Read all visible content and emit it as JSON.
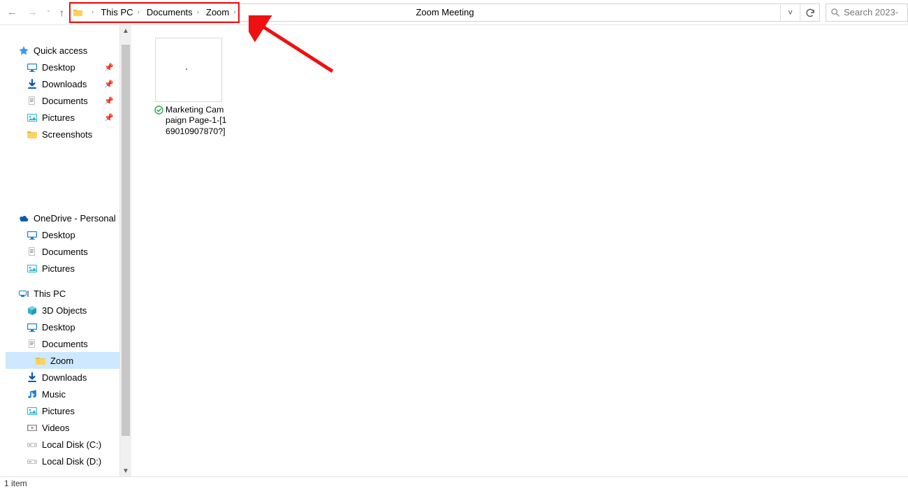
{
  "address": {
    "crumbs": [
      "This PC",
      "Documents",
      "Zoom"
    ],
    "center_label": "Zoom Meeting"
  },
  "search": {
    "placeholder": "Search 2023-"
  },
  "sidebar": {
    "quick_access": {
      "label": "Quick access",
      "items": [
        {
          "label": "Desktop",
          "icon": "desktop",
          "pinned": true
        },
        {
          "label": "Downloads",
          "icon": "downloads",
          "pinned": true
        },
        {
          "label": "Documents",
          "icon": "documents",
          "pinned": true
        },
        {
          "label": "Pictures",
          "icon": "pictures",
          "pinned": true
        },
        {
          "label": "Screenshots",
          "icon": "folder",
          "pinned": false
        }
      ]
    },
    "onedrive": {
      "label": "OneDrive - Personal",
      "items": [
        {
          "label": "Desktop",
          "icon": "desktop"
        },
        {
          "label": "Documents",
          "icon": "documents"
        },
        {
          "label": "Pictures",
          "icon": "pictures"
        }
      ]
    },
    "thispc": {
      "label": "This PC",
      "items": [
        {
          "label": "3D Objects",
          "icon": "3d"
        },
        {
          "label": "Desktop",
          "icon": "desktop"
        },
        {
          "label": "Documents",
          "icon": "documents",
          "children": [
            {
              "label": "Zoom",
              "icon": "folder",
              "selected": true
            }
          ]
        },
        {
          "label": "Downloads",
          "icon": "downloads"
        },
        {
          "label": "Music",
          "icon": "music"
        },
        {
          "label": "Pictures",
          "icon": "pictures"
        },
        {
          "label": "Videos",
          "icon": "videos"
        },
        {
          "label": "Local Disk (C:)",
          "icon": "drive"
        },
        {
          "label": "Local Disk (D:)",
          "icon": "drive"
        }
      ]
    }
  },
  "content": {
    "files": [
      {
        "name": "Marketing Campaign Page-1-[169010907870?]",
        "synced": true
      }
    ]
  },
  "statusbar": {
    "text": "1 item"
  }
}
